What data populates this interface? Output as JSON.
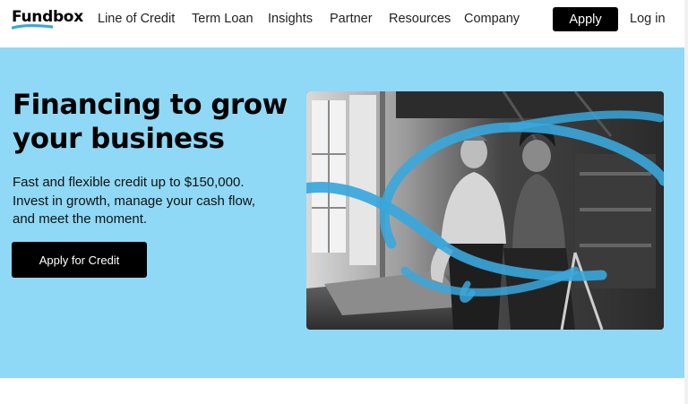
{
  "brand": {
    "name": "Fundbox",
    "accent": "#3aa7dc"
  },
  "nav": {
    "items": [
      {
        "label": "Line of Credit"
      },
      {
        "label": "Term Loan"
      },
      {
        "label": "Insights"
      },
      {
        "label": "Partner"
      },
      {
        "label": "Resources"
      },
      {
        "label": "Company"
      }
    ],
    "apply_label": "Apply",
    "login_label": "Log in"
  },
  "hero": {
    "title": "Financing to grow your business",
    "subtitle": "Fast and flexible credit up to $150,000. Invest in growth, manage your cash flow, and meet the moment.",
    "cta_label": "Apply for Credit",
    "background": "#8fd9f6",
    "photo": "two business owners in a workshop with blue brush stroke overlay"
  }
}
